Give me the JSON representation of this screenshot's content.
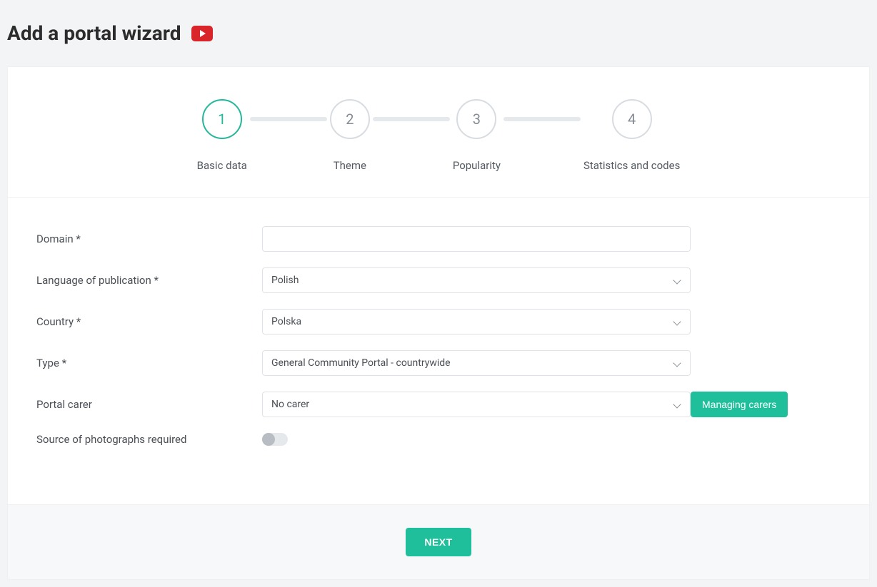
{
  "header": {
    "title": "Add a portal wizard"
  },
  "stepper": {
    "steps": [
      {
        "num": "1",
        "label": "Basic data",
        "active": true
      },
      {
        "num": "2",
        "label": "Theme",
        "active": false
      },
      {
        "num": "3",
        "label": "Popularity",
        "active": false
      },
      {
        "num": "4",
        "label": "Statistics and codes",
        "active": false
      }
    ]
  },
  "form": {
    "domain": {
      "label": "Domain *",
      "value": ""
    },
    "language": {
      "label": "Language of publication *",
      "value": "Polish"
    },
    "country": {
      "label": "Country *",
      "value": "Polska"
    },
    "type": {
      "label": "Type *",
      "value": "General Community Portal - countrywide"
    },
    "carer": {
      "label": "Portal carer",
      "value": "No carer",
      "manage_button": "Managing carers"
    },
    "photos": {
      "label": "Source of photographs required",
      "on": false
    }
  },
  "footer": {
    "next": "NEXT"
  }
}
